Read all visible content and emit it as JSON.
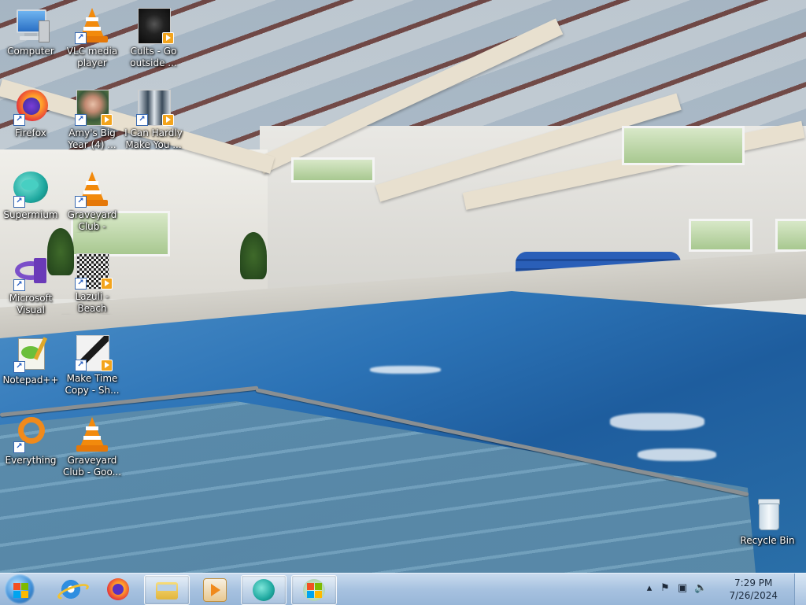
{
  "desktop": {
    "icons": [
      {
        "label": "Computer",
        "icon": "computer-icon"
      },
      {
        "label": "VLC media player",
        "icon": "vlc-cone-icon"
      },
      {
        "label": "Cults - Go outside ...",
        "icon": "video-thumbnail-icon"
      },
      {
        "label": "Firefox",
        "icon": "firefox-icon"
      },
      {
        "label": "Amy's Big Year (4) ...",
        "icon": "video-thumbnail-icon"
      },
      {
        "label": "I Can Hardly Make You ...",
        "icon": "video-thumbnail-icon"
      },
      {
        "label": "Supermium",
        "icon": "supermium-icon"
      },
      {
        "label": "Graveyard Club - Cella...",
        "icon": "vlc-cone-icon"
      },
      {
        "label": "Microsoft Visual Stud...",
        "icon": "visual-studio-icon"
      },
      {
        "label": "Lazuli - Beach House - Sh...",
        "icon": "video-thumbnail-icon"
      },
      {
        "label": "Notepad++",
        "icon": "notepad-plus-plus-icon"
      },
      {
        "label": "Make Time Copy - Sh...",
        "icon": "video-thumbnail-icon"
      },
      {
        "label": "Everything",
        "icon": "everything-search-icon"
      },
      {
        "label": "Graveyard Club - Goo...",
        "icon": "vlc-cone-icon"
      },
      {
        "label": "Recycle Bin",
        "icon": "recycle-bin-icon"
      }
    ]
  },
  "taskbar": {
    "start_icon": "windows-start-orb-icon",
    "pinned": [
      {
        "name": "Internet Explorer",
        "icon": "internet-explorer-icon",
        "open": false
      },
      {
        "name": "Firefox",
        "icon": "firefox-icon",
        "open": false
      },
      {
        "name": "Windows Explorer",
        "icon": "folder-icon",
        "open": true
      },
      {
        "name": "Windows Media Player",
        "icon": "media-player-icon",
        "open": false
      },
      {
        "name": "Supermium",
        "icon": "supermium-icon",
        "open": true
      },
      {
        "name": "Windows",
        "icon": "windows-logo-icon",
        "open": true
      }
    ],
    "tray": {
      "icons": [
        "show-hidden-icons-chevron",
        "action-center-flag-icon",
        "network-icon",
        "volume-icon"
      ],
      "time": "7:29 PM",
      "date": "7/26/2024"
    }
  },
  "colors": {
    "taskbar": "#a7c2e0",
    "label_text": "#ffffff",
    "vlc_orange": "#f28a0c",
    "firefox_orange": "#ff7139",
    "supermium_teal": "#1fa9a0"
  }
}
